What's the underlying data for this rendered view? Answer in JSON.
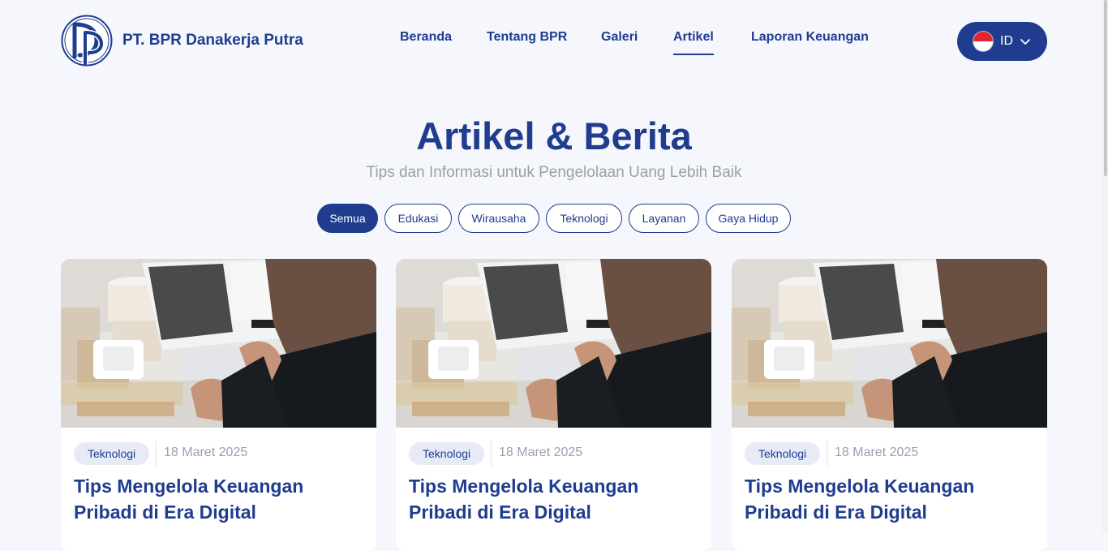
{
  "header": {
    "brand": "PT. BPR Danakerja Putra",
    "logo_icon": "dp-monogram-logo",
    "nav": [
      {
        "label": "Beranda",
        "active": false
      },
      {
        "label": "Tentang BPR",
        "active": false
      },
      {
        "label": "Galeri",
        "active": false
      },
      {
        "label": "Artikel",
        "active": true
      },
      {
        "label": "Laporan Keuangan",
        "active": false
      }
    ],
    "language": {
      "label": "ID",
      "flag_icon": "indonesia-flag-icon",
      "chevron_icon": "chevron-down-icon"
    }
  },
  "hero": {
    "title": "Artikel & Berita",
    "subtitle": "Tips dan Informasi untuk Pengelolaan Uang Lebih Baik"
  },
  "filters": [
    {
      "label": "Semua",
      "active": true
    },
    {
      "label": "Edukasi",
      "active": false
    },
    {
      "label": "Wirausaha",
      "active": false
    },
    {
      "label": "Teknologi",
      "active": false
    },
    {
      "label": "Layanan",
      "active": false
    },
    {
      "label": "Gaya Hidup",
      "active": false
    }
  ],
  "articles": [
    {
      "category": "Teknologi",
      "date": "18 Maret 2025",
      "title": "Tips Mengelola Keuangan Pribadi di Era Digital",
      "image": "pos-terminal-photo"
    },
    {
      "category": "Teknologi",
      "date": "18 Maret 2025",
      "title": "Tips Mengelola Keuangan Pribadi di Era Digital",
      "image": "pos-terminal-photo"
    },
    {
      "category": "Teknologi",
      "date": "18 Maret 2025",
      "title": "Tips Mengelola Keuangan Pribadi di Era Digital",
      "image": "pos-terminal-photo"
    }
  ],
  "colors": {
    "primary": "#1f3c8f",
    "background": "#f5f7fc",
    "muted_text": "#9aa0a8",
    "badge_bg": "#e6ebf6"
  }
}
